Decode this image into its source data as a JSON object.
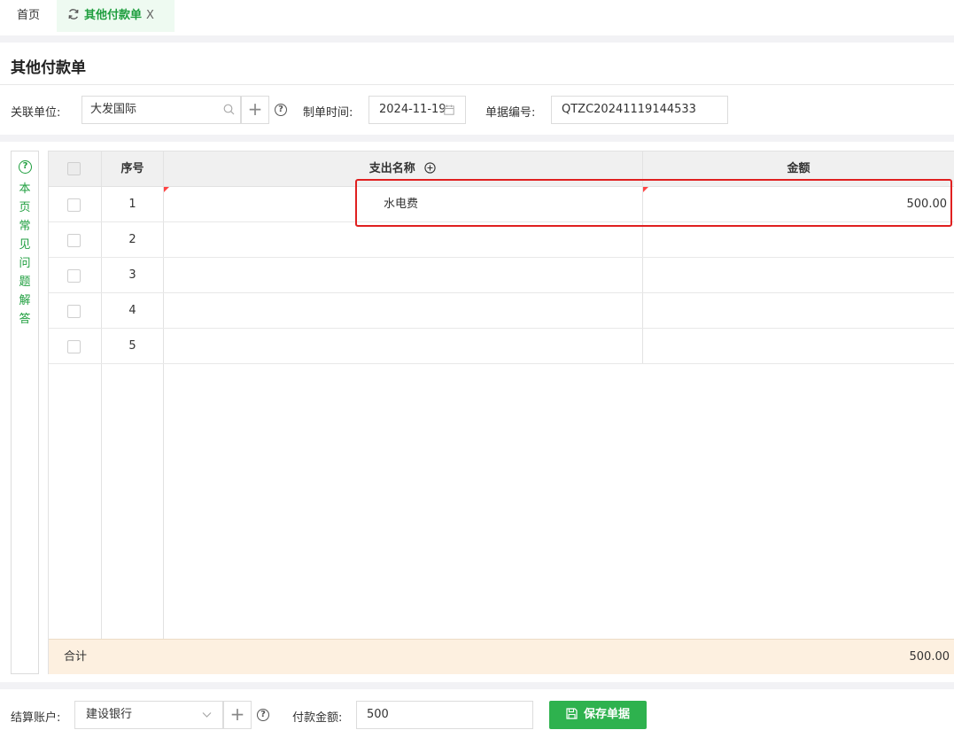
{
  "tabs": {
    "home": "首页",
    "active": "其他付款单",
    "close": "X"
  },
  "page": {
    "title": "其他付款单"
  },
  "form": {
    "unit_label": "关联单位:",
    "unit_value": "大发国际",
    "date_label": "制单时间:",
    "date_value": "2024-11-19",
    "code_label": "单据编号:",
    "code_value": "QTZC20241119144533"
  },
  "faq": {
    "text": "本页常见问题解答"
  },
  "table": {
    "headers": {
      "index": "序号",
      "name": "支出名称",
      "amount": "金额"
    },
    "rows": [
      {
        "index": "1",
        "name": "水电费",
        "amount": "500.00"
      },
      {
        "index": "2",
        "name": "",
        "amount": ""
      },
      {
        "index": "3",
        "name": "",
        "amount": ""
      },
      {
        "index": "4",
        "name": "",
        "amount": ""
      },
      {
        "index": "5",
        "name": "",
        "amount": ""
      }
    ],
    "total_label": "合计",
    "total_amount": "500.00"
  },
  "footer": {
    "account_label": "结算账户:",
    "account_value": "建设银行",
    "pay_label": "付款金额:",
    "pay_value": "500",
    "save_label": "保存单据"
  },
  "colors": {
    "accent": "#2eb24e",
    "highlight": "#e02020",
    "total_bg": "#fdf0e0"
  }
}
